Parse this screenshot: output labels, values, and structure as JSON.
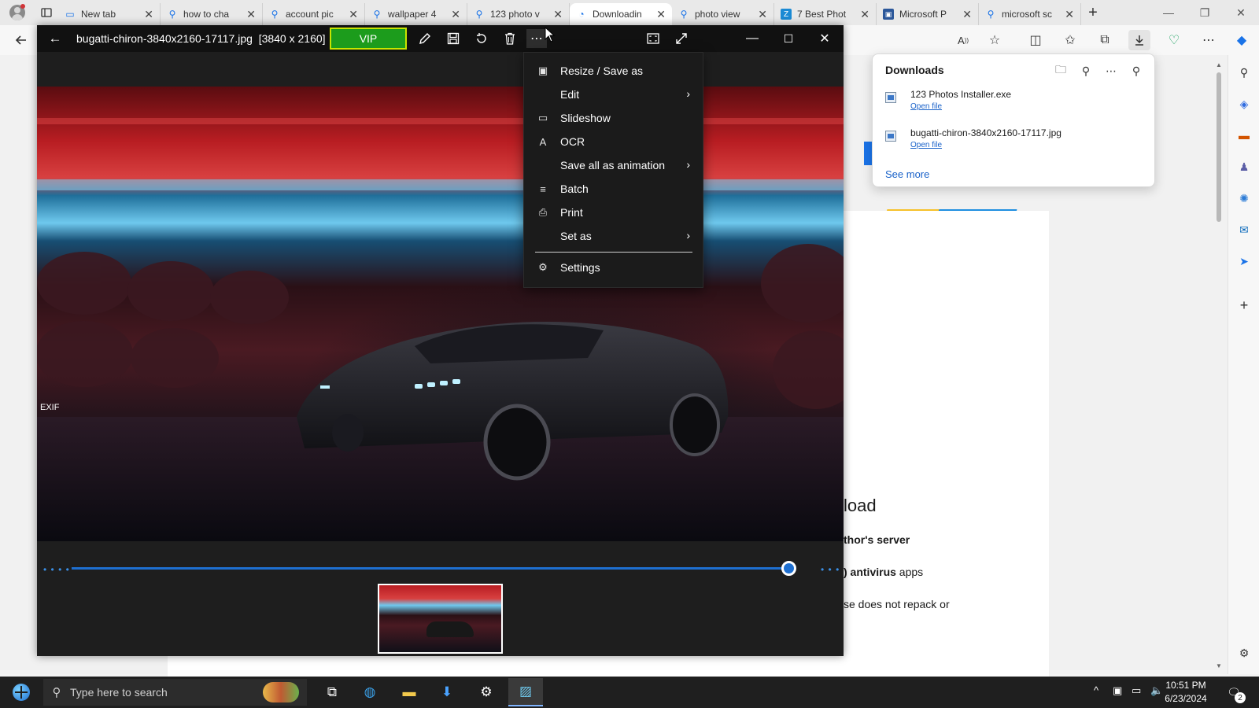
{
  "browser": {
    "tabs": [
      {
        "title": "New tab",
        "icon": "newtab-icon"
      },
      {
        "title": "how to cha",
        "icon": "search-icon"
      },
      {
        "title": "account pic",
        "icon": "search-icon"
      },
      {
        "title": "wallpaper 4",
        "icon": "search-icon"
      },
      {
        "title": "123 photo v",
        "icon": "search-icon"
      },
      {
        "title": "Downloadin",
        "icon": "loading-icon",
        "active": true
      },
      {
        "title": "photo view",
        "icon": "search-icon"
      },
      {
        "title": "7 Best Phot",
        "icon": "site-icon"
      },
      {
        "title": "Microsoft P",
        "icon": "store-icon"
      },
      {
        "title": "microsoft sc",
        "icon": "search-icon"
      }
    ],
    "close_glyph": "✕",
    "new_tab_glyph": "+",
    "downloads": {
      "title": "Downloads",
      "items": [
        {
          "name": "123 Photos Installer.exe",
          "action": "Open file"
        },
        {
          "name": "bugatti-chiron-3840x2160-17117.jpg",
          "action": "Open file"
        }
      ],
      "see_more": "See more"
    },
    "page": {
      "heading_fragment": "load",
      "line1": "thor's server",
      "line2_bold": ") antivirus",
      "line2_rest": " apps",
      "line3": "se does not repack or"
    }
  },
  "viewer": {
    "file_name": "bugatti-chiron-3840x2160-17117.jpg",
    "dimensions": "[3840 x 2160]",
    "vip_label": "VIP",
    "exif_label": "EXIF",
    "slider_value": 0.99,
    "menu": [
      {
        "label": "Resize / Save as",
        "icon": "save-icon",
        "submenu": false
      },
      {
        "label": "Edit",
        "icon": "",
        "submenu": true
      },
      {
        "label": "Slideshow",
        "icon": "slideshow-icon",
        "submenu": false
      },
      {
        "label": "OCR",
        "icon": "ocr-icon",
        "submenu": false
      },
      {
        "label": "Save all as animation",
        "icon": "",
        "submenu": true
      },
      {
        "label": "Batch",
        "icon": "batch-icon",
        "submenu": false
      },
      {
        "label": "Print",
        "icon": "print-icon",
        "submenu": false
      },
      {
        "label": "Set as",
        "icon": "",
        "submenu": true
      },
      {
        "label": "Settings",
        "icon": "gear-icon",
        "submenu": false
      }
    ]
  },
  "taskbar": {
    "search_placeholder": "Type here to search",
    "time": "10:51 PM",
    "date": "6/23/2024",
    "notification_count": "2"
  },
  "colors": {
    "accent": "#1e6fd0",
    "vip_green": "#1c9c1c",
    "vip_border": "#c8e400",
    "menu_bg": "#1b1b1b",
    "taskbar_bg": "#1f1f1f"
  }
}
